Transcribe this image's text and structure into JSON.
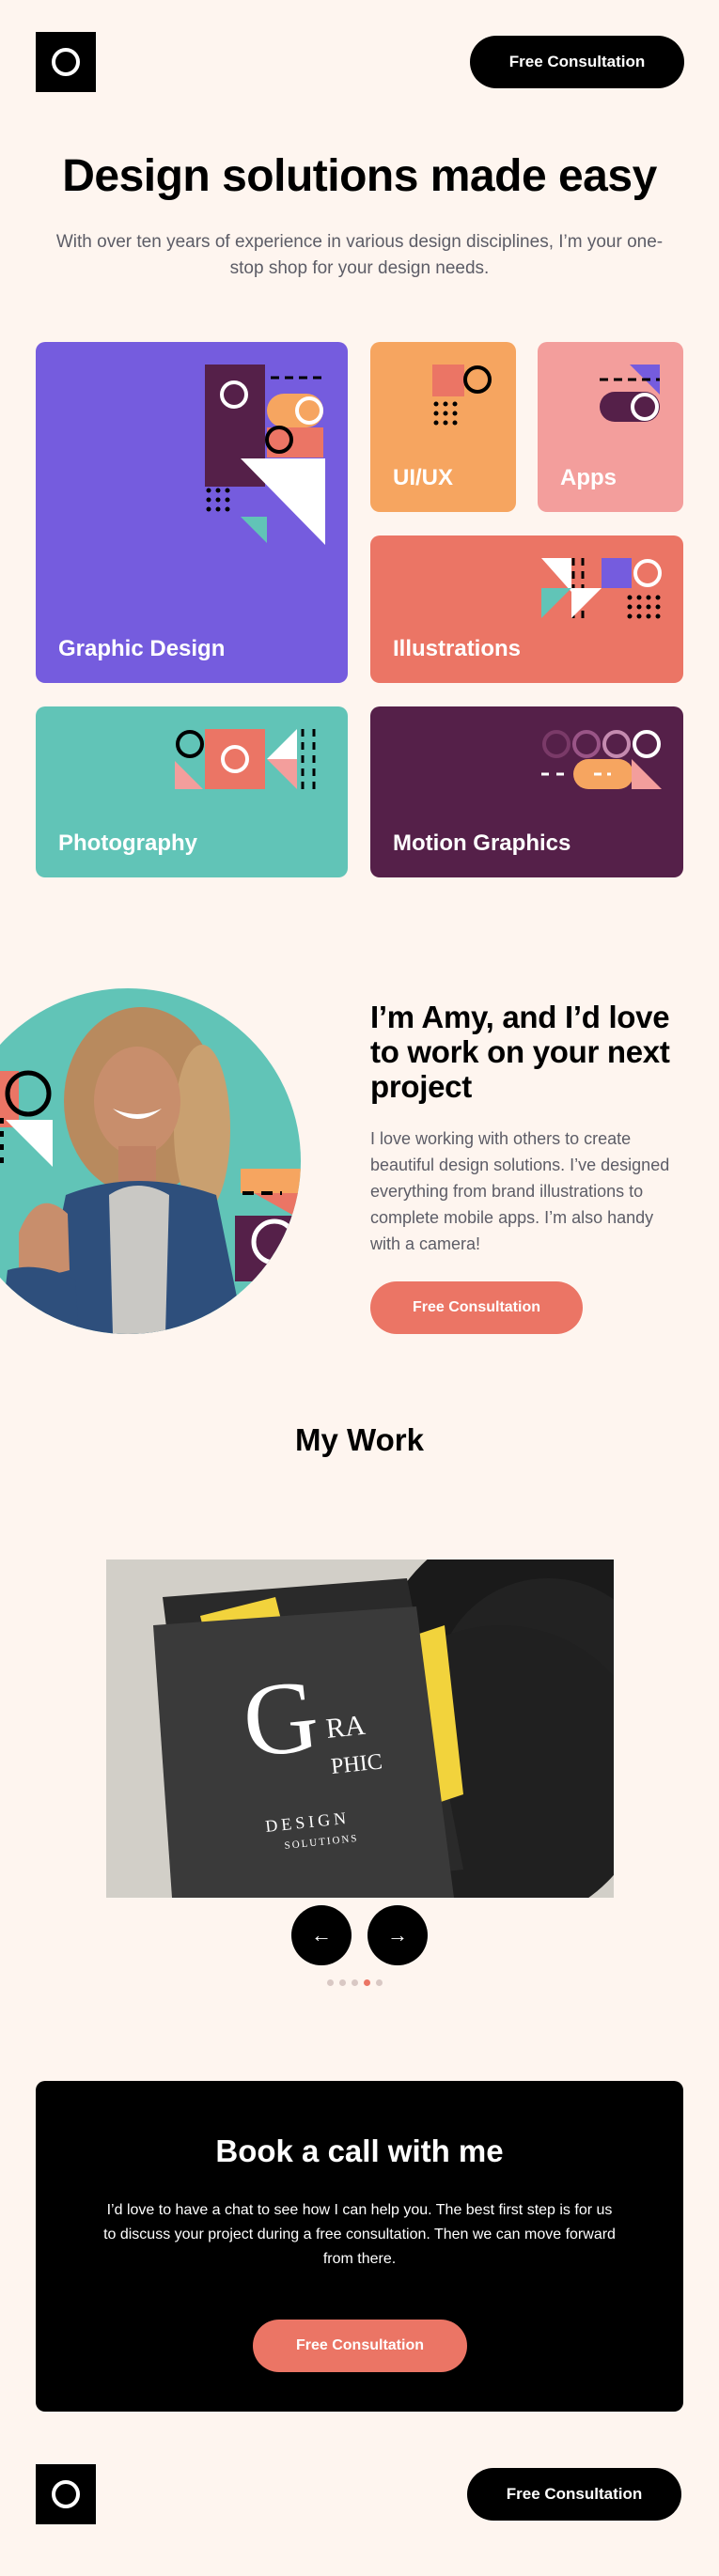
{
  "header": {
    "cta_label": "Free Consultation"
  },
  "hero": {
    "title": "Design solutions made easy",
    "subtitle": "With over ten years of experience in various design disciplines, I’m your one-stop shop for your design needs."
  },
  "services": [
    {
      "label": "Graphic Design",
      "color": "#755CDE"
    },
    {
      "label": "UI/UX",
      "color": "#F6A560"
    },
    {
      "label": "Apps",
      "color": "#F39E9C"
    },
    {
      "label": "Illustrations",
      "color": "#EB7565"
    },
    {
      "label": "Photography",
      "color": "#61C4B7"
    },
    {
      "label": "Motion Graphics",
      "color": "#552049"
    }
  ],
  "about": {
    "title": "I’m Amy, and I’d love to work on your next project",
    "text": "I love working with others to create beautiful design solutions. I’ve designed everything from brand illustrations to complete mobile apps. I’m also handy with a camera!",
    "cta_label": "Free Consultation"
  },
  "work": {
    "title": "My Work",
    "prev_icon": "arrow-left-icon",
    "next_icon": "arrow-right-icon",
    "slide_count": 5,
    "active_slide": 4,
    "book_text": {
      "big": "G",
      "line1": "RA",
      "line2": "PHIC",
      "line3": "DESIGN",
      "line4": "SOLUTIONS"
    }
  },
  "cta": {
    "title": "Book a call with me",
    "text": "I’d love to have a chat to see how I can help you. The best first step is for us to discuss your project during a free consultation. Then we can move forward from there.",
    "button_label": "Free Consultation"
  },
  "footer": {
    "cta_label": "Free Consultation"
  },
  "colors": {
    "background": "#FEF5EF",
    "coral": "#EB7565",
    "purple": "#755CDE",
    "teal": "#61C4B7",
    "plum": "#552049",
    "orange": "#F6A560",
    "pink": "#F39E9C"
  }
}
